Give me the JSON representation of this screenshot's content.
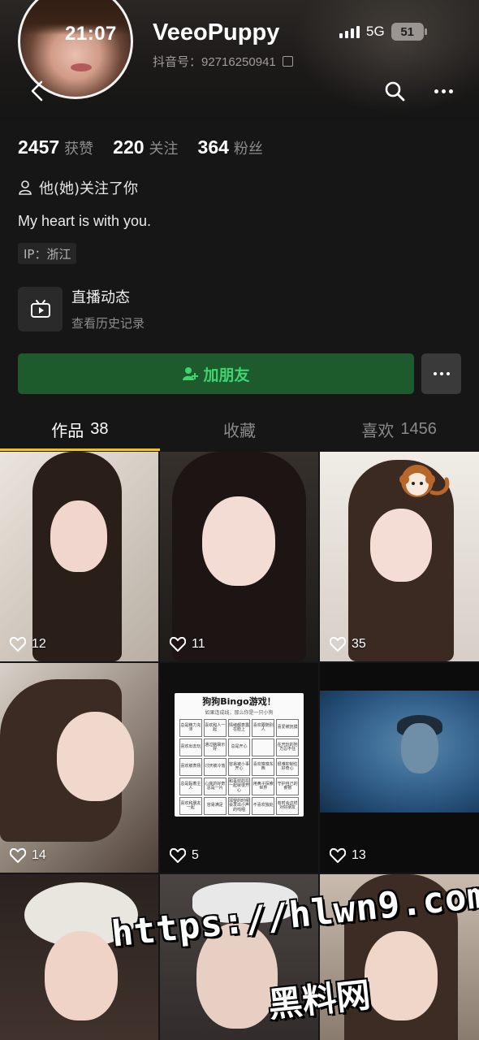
{
  "status_bar": {
    "time": "21:07",
    "network": "5G",
    "battery": "51"
  },
  "profile": {
    "username": "VeeoPuppy",
    "douyin_id": "抖音号：92716250941",
    "stats": [
      {
        "num": "2457",
        "label": "获赞"
      },
      {
        "num": "220",
        "label": "关注"
      },
      {
        "num": "364",
        "label": "粉丝"
      }
    ],
    "follow_note": "他(她)关注了你",
    "bio": "My heart is with you.",
    "ip": "IP：浙江"
  },
  "live": {
    "title": "直播动态",
    "subtitle": "查看历史记录"
  },
  "actions": {
    "add_friend": "加朋友"
  },
  "tabs": [
    {
      "label": "作品",
      "count": "38",
      "active": true
    },
    {
      "label": "收藏",
      "count": "",
      "active": false
    },
    {
      "label": "喜欢",
      "count": "1456",
      "active": false
    }
  ],
  "posts": [
    {
      "likes": "12"
    },
    {
      "likes": "11"
    },
    {
      "likes": "35"
    },
    {
      "likes": "14"
    },
    {
      "likes": "5"
    },
    {
      "likes": "13"
    },
    {
      "likes": ""
    },
    {
      "likes": ""
    },
    {
      "likes": ""
    }
  ],
  "bingo": {
    "title": "狗狗Bingo游戏！",
    "subtitle": "如果连成线，那么你是一只小狗",
    "cells": [
      "总是精力充沛",
      "喜欢和人一起",
      "情绪都表露在脸上",
      "喜欢跟随别人",
      "喜爱被抚摸",
      "喜欢出去玩",
      "通过脑袋示好",
      "总是开心",
      "",
      "在开玩的地方忍不住",
      "喜欢被表扬",
      "讨厌被冷落",
      "容易被小事开心",
      "喜欢嗅嗅东西",
      "很难抑制住好奇心",
      "总是黏着主人",
      "心底的好奇总是一片",
      "和喜欢的在一起就很开心",
      "用鼻子探索世界",
      "守护自己的食物",
      "喜欢和朋友一起",
      "容易满足",
      "渴望的时候会发出小声的呜咽",
      "不喜欢独处",
      "有时会这样对好朋友"
    ]
  },
  "watermark": {
    "url": "https://hlwn9.com",
    "name": "黑料网"
  },
  "colors": {
    "accent_tab": "#f4c21f",
    "add_friend_bg": "#1d5a2c",
    "add_friend_text": "#3fd470"
  }
}
